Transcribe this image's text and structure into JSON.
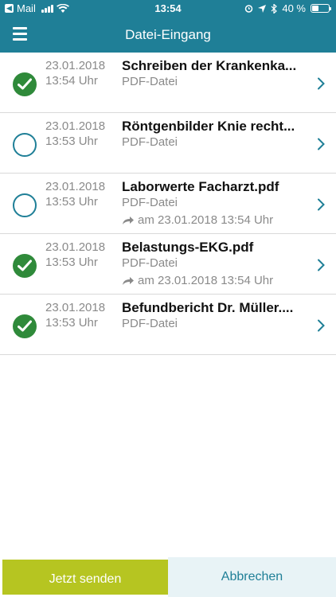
{
  "status": {
    "back_app": "Mail",
    "time": "13:54",
    "battery": "40 %",
    "battery_level": 0.4
  },
  "nav": {
    "title": "Datei-Eingang",
    "menu_icon": "hamburger-menu-icon"
  },
  "files": [
    {
      "selected": true,
      "date": "23.01.2018",
      "time": "13:54 Uhr",
      "name": "Schreiben der Krankenka...",
      "type": "PDF-Datei",
      "forwarded": ""
    },
    {
      "selected": false,
      "date": "23.01.2018",
      "time": "13:53 Uhr",
      "name": "Röntgenbilder Knie recht...",
      "type": "PDF-Datei",
      "forwarded": ""
    },
    {
      "selected": false,
      "date": "23.01.2018",
      "time": "13:53 Uhr",
      "name": "Laborwerte Facharzt.pdf",
      "type": "PDF-Datei",
      "forwarded": "am 23.01.2018 13:54 Uhr"
    },
    {
      "selected": true,
      "date": "23.01.2018",
      "time": "13:53 Uhr",
      "name": "Belastungs-EKG.pdf",
      "type": "PDF-Datei",
      "forwarded": "am 23.01.2018 13:54 Uhr"
    },
    {
      "selected": true,
      "date": "23.01.2018",
      "time": "13:53 Uhr",
      "name": "Befundbericht Dr. Müller....",
      "type": "PDF-Datei",
      "forwarded": ""
    }
  ],
  "actions": {
    "send_label": "Jetzt senden",
    "cancel_label": "Abbrechen"
  },
  "colors": {
    "primary": "#1f7f97",
    "checked": "#2f8a3a",
    "send": "#b6c521",
    "cancel_bg": "#e8f3f6"
  }
}
